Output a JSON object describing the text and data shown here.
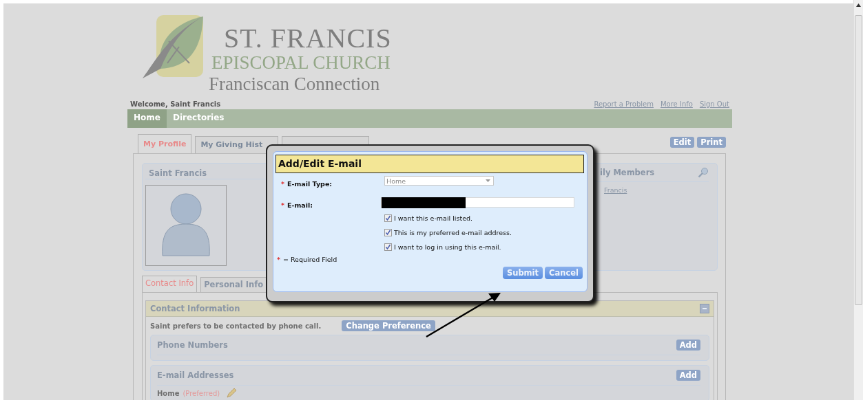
{
  "logo": {
    "title": "ST. FRANCIS",
    "subtitle": "EPISCOPAL CHURCH",
    "tagline": "Franciscan Connection"
  },
  "welcome": "Welcome, Saint Francis",
  "header_links": [
    "Report a Problem",
    "More Info",
    "Sign Out"
  ],
  "nav": [
    {
      "label": "Home",
      "selected": true
    },
    {
      "label": "Directories",
      "selected": false
    }
  ],
  "tabs": [
    {
      "label": "My Profile",
      "selected": true
    },
    {
      "label": "My Giving Hist",
      "selected": false
    }
  ],
  "actions": [
    "Edit",
    "Print"
  ],
  "profile": {
    "name": "Saint Francis"
  },
  "family": {
    "title": "ily Members",
    "members": [
      "Francis"
    ]
  },
  "sub_tabs": [
    {
      "label": "Contact Info",
      "selected": true
    },
    {
      "label": "Personal Info",
      "selected": false
    }
  ],
  "contact": {
    "title": "Contact Information",
    "expanded": true,
    "preference": "Saint prefers to be contacted by phone call.",
    "change_button": "Change Preference",
    "sections": [
      {
        "title": "Phone Numbers",
        "button": "Add"
      },
      {
        "title": "E-mail Addresses",
        "button": "Add",
        "entries": [
          {
            "type": "Home",
            "note": "(Preferred)"
          }
        ]
      }
    ]
  },
  "dialog": {
    "title": "Add/Edit E-mail",
    "required_mark": "*",
    "fields": [
      {
        "kind": "select",
        "label": "E-mail Type:",
        "required": true,
        "value": "Home"
      },
      {
        "kind": "text",
        "label": "E-mail:",
        "required": true,
        "redacted": true
      }
    ],
    "options": [
      {
        "label": "I want this e-mail listed.",
        "checked": true
      },
      {
        "label": "This is my preferred e-mail address.",
        "checked": true
      },
      {
        "label": "I want to log in using this e-mail.",
        "checked": true
      }
    ],
    "required_note": "= Required Field",
    "buttons": [
      "Submit",
      "Cancel"
    ]
  }
}
